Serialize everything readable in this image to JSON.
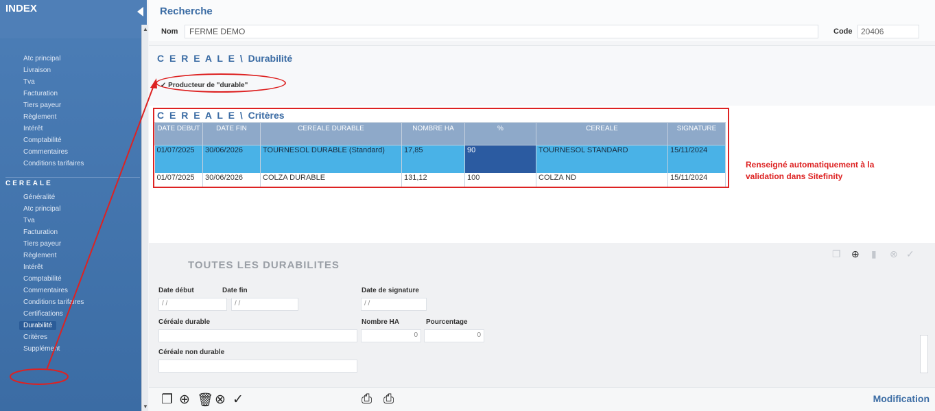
{
  "sidebar": {
    "title": "INDEX",
    "items_top": [
      "Atc principal",
      "Livraison",
      "Tva",
      "Facturation",
      "Tiers payeur",
      "Règlement",
      "Intérêt",
      "Comptabilité",
      "Commentaires",
      "Conditions tarifaires"
    ],
    "section": "CEREALE",
    "items_cereale": [
      "Généralité",
      "Atc principal",
      "Tva",
      "Facturation",
      "Tiers payeur",
      "Règlement",
      "Intérêt",
      "Comptabilité",
      "Commentaires",
      "Conditions tarifaires",
      "Certifications",
      "Durabilité",
      "Critères",
      "Supplément"
    ],
    "active_item": "Durabilité"
  },
  "header": {
    "title": "Recherche",
    "name_label": "Nom",
    "name_value": "FERME DEMO",
    "code_label": "Code",
    "code_value": "20406"
  },
  "durabilite": {
    "title_prefix": "C E R E A L E \\",
    "title_suffix": "Durabilité",
    "checkbox_label": "✓ Producteur de \"durable\""
  },
  "criteres": {
    "title_prefix": "C E R E A L E \\",
    "title_suffix": "Critères",
    "columns": [
      "DATE DEBUT",
      "DATE FIN",
      "CEREALE DURABLE",
      "NOMBRE HA",
      "%",
      "CEREALE",
      "SIGNATURE"
    ],
    "rows": [
      [
        "01/07/2025",
        "30/06/2026",
        "TOURNESOL DURABLE (Standard)",
        "17,85",
        "90",
        "TOURNESOL STANDARD",
        "15/11/2024"
      ],
      [
        "01/07/2025",
        "30/06/2026",
        "COLZA DURABLE",
        "131,12",
        "100",
        "COLZA ND",
        "15/11/2024"
      ]
    ]
  },
  "annotation": {
    "line1": "Renseigné automatiquement à la",
    "line2": "validation dans Sitefinity"
  },
  "form": {
    "title": "TOUTES LES DURABILITES",
    "date_debut_label": "Date début",
    "date_fin_label": "Date fin",
    "date_signature_label": "Date de signature",
    "date_placeholder": "/ /",
    "cereale_durable_label": "Céréale durable",
    "nombre_ha_label": "Nombre HA",
    "pourcentage_label": "Pourcentage",
    "nombre_ha_value": "0",
    "pourcentage_value": "0",
    "cereale_non_durable_label": "Céréale non durable"
  },
  "status": {
    "mode": "Modification"
  },
  "colors": {
    "accent": "#3b6ca4",
    "highlight_red": "#dd2222",
    "selected_row": "#49b2e7",
    "selected_cell": "#2b5ba1"
  }
}
